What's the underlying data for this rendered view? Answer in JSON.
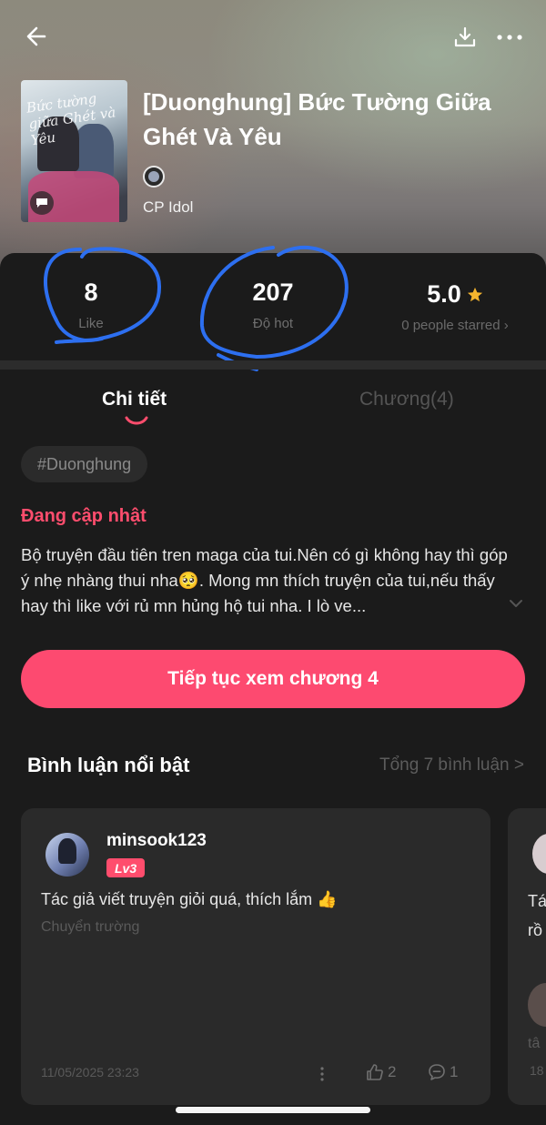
{
  "header": {
    "book_title": "[Duonghung] Bức Tường Giữa Ghét Và Yêu",
    "author": "CP Idol",
    "cover_script": "Bức tường giữa Ghét và Yêu",
    "icons": [
      "back-arrow-icon",
      "download-icon",
      "more-icon"
    ]
  },
  "stats": {
    "likes": {
      "value": "8",
      "label": "Like"
    },
    "hot": {
      "value": "207",
      "label": "Độ hot"
    },
    "rating": {
      "value": "5.0",
      "label": "0 people starred ›"
    }
  },
  "tabs": [
    {
      "label": "Chi tiết",
      "active": true
    },
    {
      "label": "Chương(4)",
      "active": false
    }
  ],
  "detail": {
    "tag": "#Duonghung",
    "status": "Đang cập nhật",
    "description": "Bộ truyện đầu tiên tren maga của tui.Nên có gì không hay thì góp ý nhẹ nhàng thui nha🥺. Mong mn thích truyện của tui,nếu thấy hay thì like với rủ mn hủng hộ tui nha. I lò ve..."
  },
  "cta": {
    "label": "Tiếp tục xem chương 4"
  },
  "comments_section": {
    "title": "Bình luận nổi bật",
    "more": "Tổng 7 bình luận >",
    "items": [
      {
        "user": "minsook123",
        "level": "Lv3",
        "text": "Tác giả viết truyện giỏi quá, thích lắm 👍",
        "subtitle": "Chuyển trường",
        "date": "11/05/2025 23:23",
        "likes": "2",
        "replies": "1"
      }
    ],
    "peek": {
      "t1": "Tá",
      "t2": "rồ",
      "t3": "tâ",
      "t4": "18"
    }
  },
  "colors": {
    "accent": "#fd4a70",
    "status": "#ff4d6d",
    "annotation": "#2d6ff0",
    "star": "#f5b52e"
  }
}
